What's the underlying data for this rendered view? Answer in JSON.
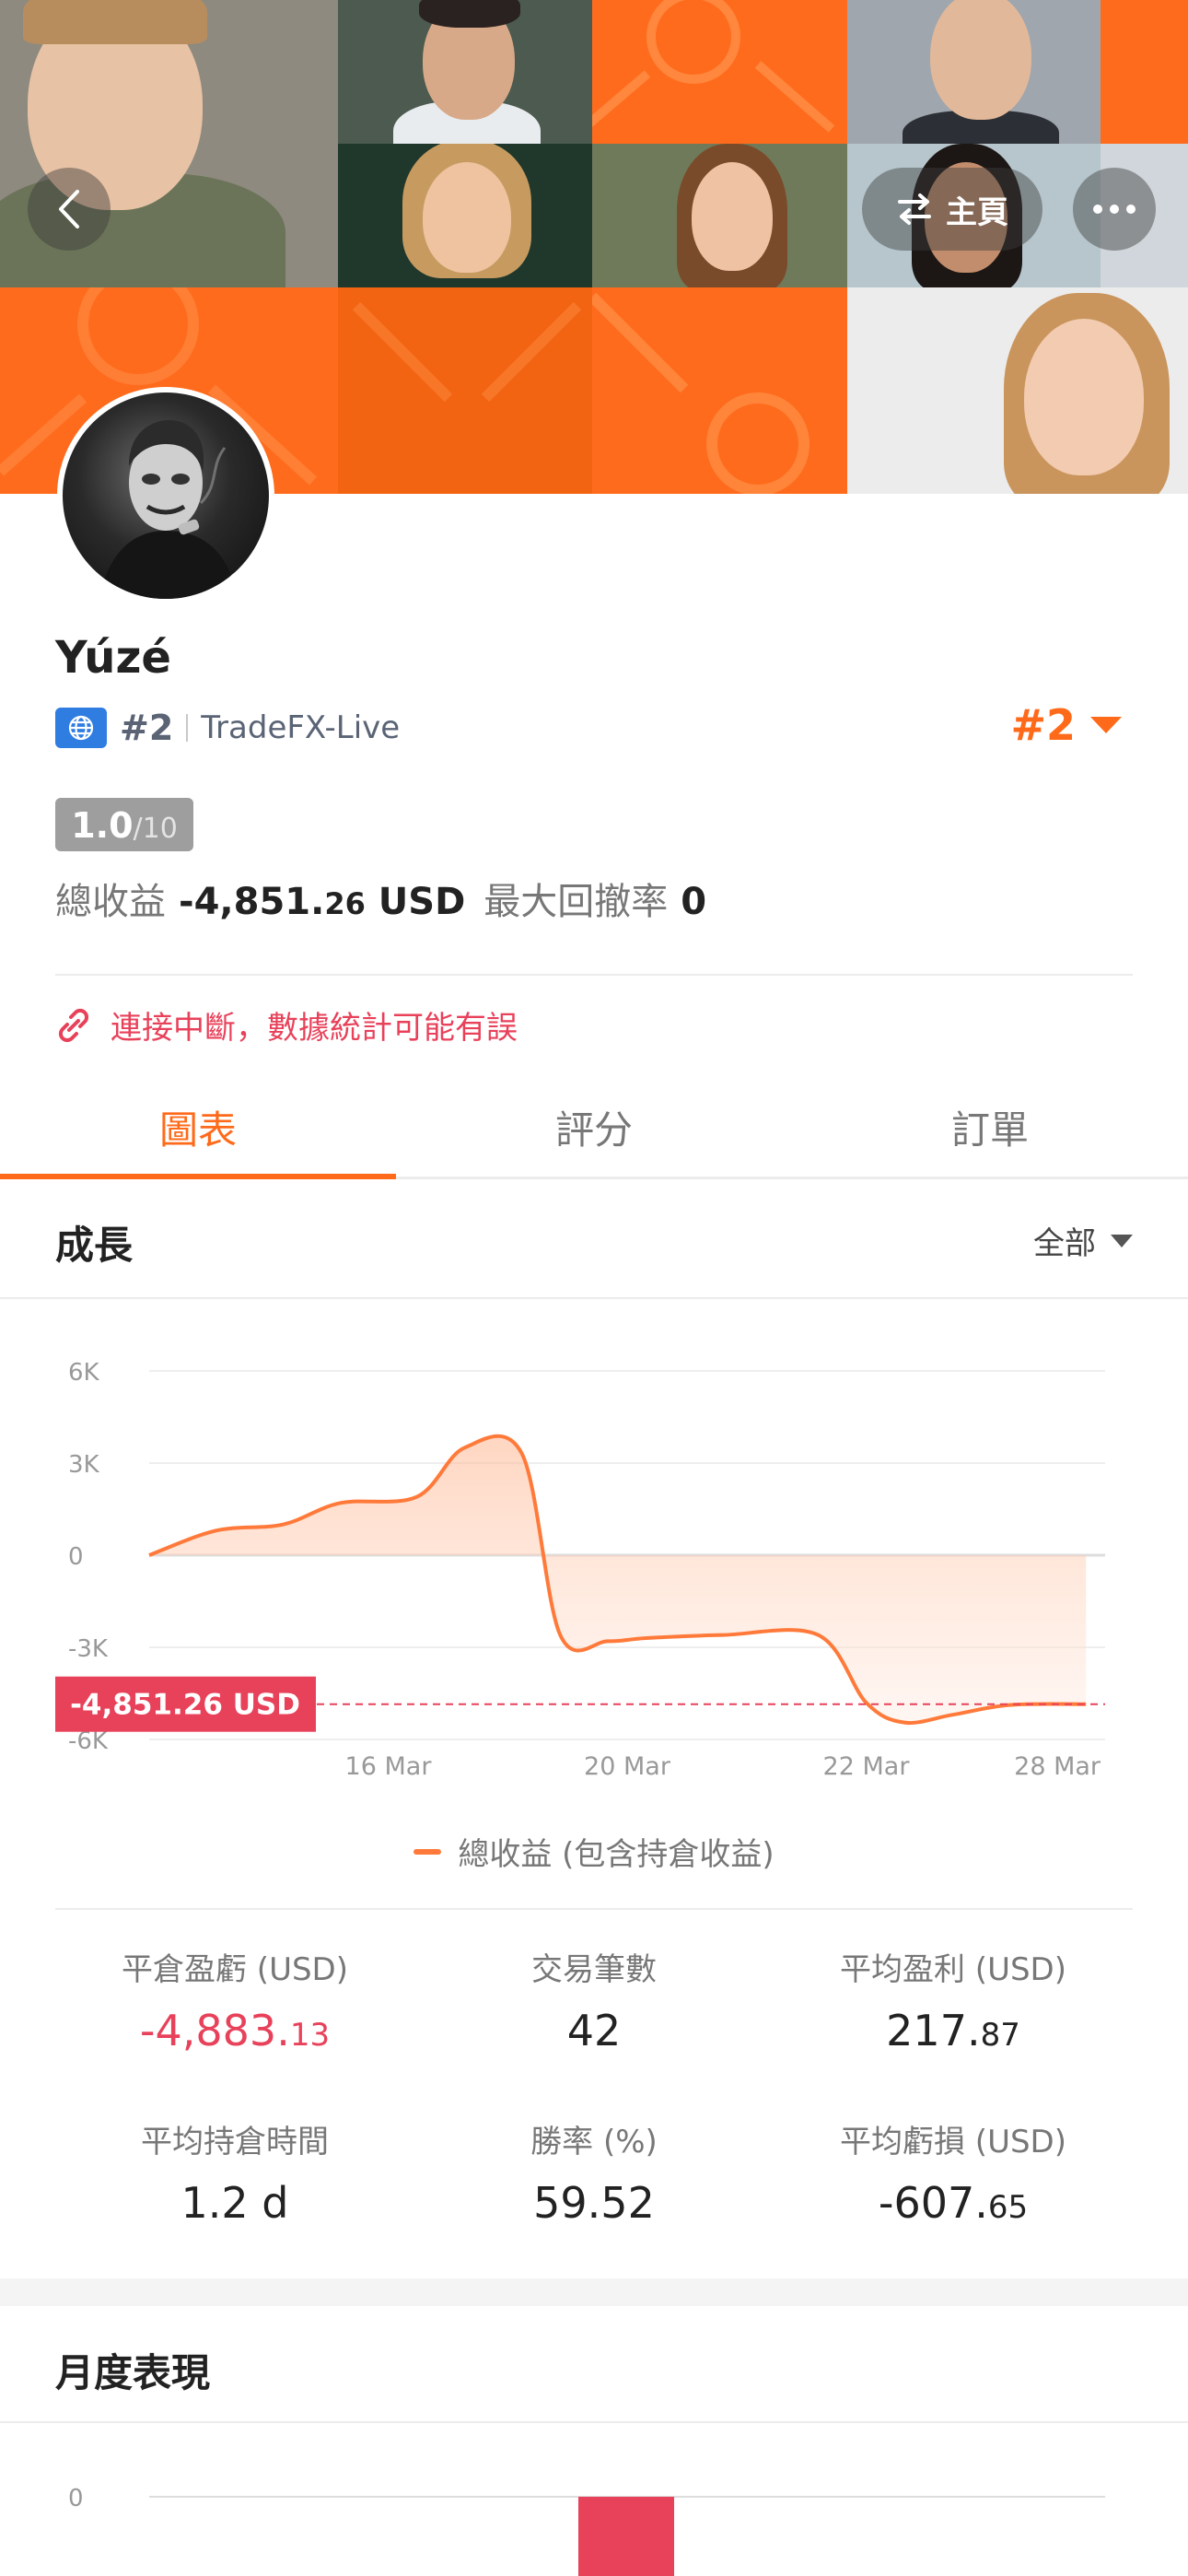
{
  "header": {
    "home_label": "主頁"
  },
  "profile": {
    "username": "Yúzé",
    "rank_small": "#2",
    "server": "TradeFX-Live",
    "rank_big": "#2",
    "score_value": "1.0",
    "score_max": "/10",
    "total_profit_label": "總收益",
    "total_profit_int": "-4,851.",
    "total_profit_dec": "26",
    "total_profit_unit": "USD",
    "max_drawdown_label": "最大回撤率",
    "max_drawdown_value": "0",
    "warning": "連接中斷，數據統計可能有誤"
  },
  "tabs": [
    {
      "label": "圖表",
      "active": true
    },
    {
      "label": "評分",
      "active": false
    },
    {
      "label": "訂單",
      "active": false
    }
  ],
  "growth": {
    "title": "成長",
    "filter_label": "全部"
  },
  "chart_data": {
    "type": "area",
    "title": "",
    "xlabel": "",
    "ylabel": "",
    "y_ticks": [
      "6K",
      "3K",
      "0",
      "-3K",
      "-6K"
    ],
    "y_tick_values": [
      6000,
      3000,
      0,
      -3000,
      -6000
    ],
    "ylim": [
      -6000,
      6000
    ],
    "x_ticks": [
      "16 Mar",
      "20 Mar",
      "22 Mar",
      "28 Mar"
    ],
    "x_tick_values": [
      2.5,
      5,
      7.5,
      9.5
    ],
    "x": [
      0,
      0.7,
      1.4,
      2.0,
      2.8,
      3.3,
      3.9,
      4.3,
      4.8,
      5.2,
      6.0,
      7.0,
      7.5,
      7.9,
      8.4,
      9.0,
      9.8
    ],
    "series": [
      {
        "name": "總收益 (包含持倉收益)",
        "values": [
          0,
          800,
          1000,
          1700,
          1900,
          3500,
          3300,
          -2600,
          -2800,
          -2700,
          -2600,
          -2600,
          -4800,
          -5450,
          -5200,
          -4880,
          -4851
        ]
      }
    ],
    "current_marker_label": "-4,851.26 USD",
    "current_marker_value": -4851.26,
    "colors": {
      "line": "#ff7a3a",
      "marker": "#e8415a"
    },
    "legend_position": "bottom",
    "grid": true
  },
  "legend_label": "總收益 (包含持倉收益)",
  "metrics": [
    {
      "label": "平倉盈虧 (USD)",
      "int": "-4,883.",
      "dec": "13",
      "red": true
    },
    {
      "label": "交易筆數",
      "int": "42",
      "dec": "",
      "red": false
    },
    {
      "label": "平均盈利 (USD)",
      "int": "217.",
      "dec": "87",
      "red": false
    },
    {
      "label": "平均持倉時間",
      "int": "1.2 d",
      "dec": "",
      "red": false
    },
    {
      "label": "勝率 (%)",
      "int": "59.52",
      "dec": "",
      "red": false
    },
    {
      "label": "平均虧損 (USD)",
      "int": "-607.",
      "dec": "65",
      "red": false
    }
  ],
  "monthly": {
    "title": "月度表現",
    "y_tick": "0"
  }
}
